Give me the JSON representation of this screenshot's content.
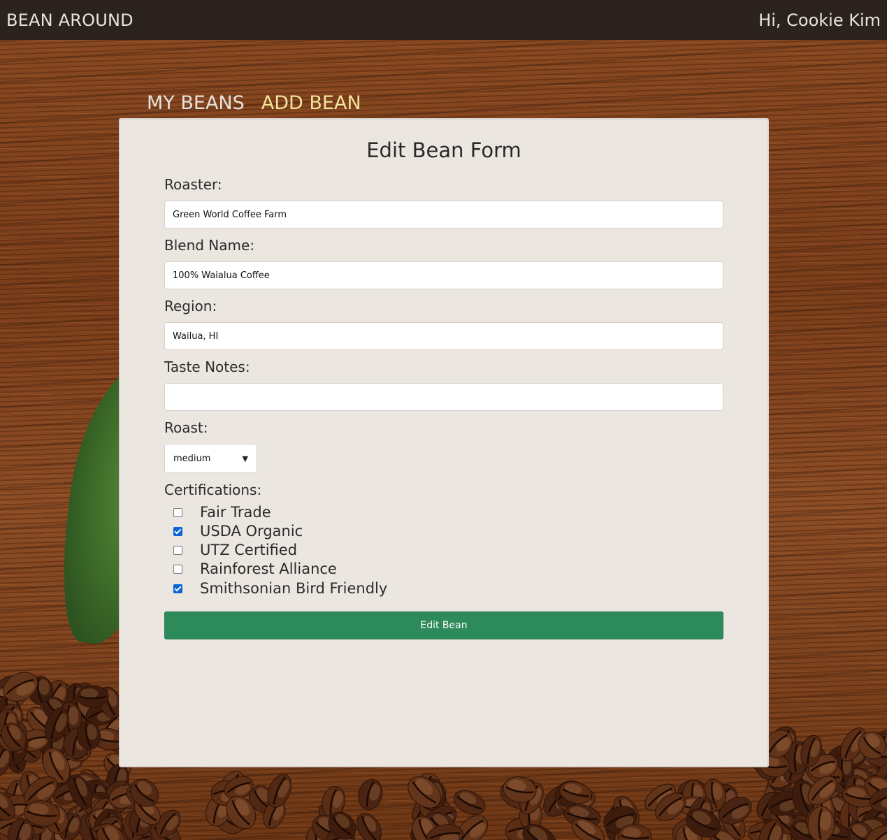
{
  "navbar": {
    "brand": "BEAN AROUND",
    "greeting": "Hi, Cookie Kim"
  },
  "tabs": {
    "my_beans": "MY BEANS",
    "add_bean": "ADD BEAN"
  },
  "form": {
    "title": "Edit Bean Form",
    "roaster_label": "Roaster:",
    "roaster_value": "Green World Coffee Farm",
    "blend_label": "Blend Name:",
    "blend_value": "100% Waialua Coffee",
    "region_label": "Region:",
    "region_value": "Wailua, HI",
    "taste_label": "Taste Notes:",
    "taste_value": "",
    "roast_label": "Roast:",
    "roast_value": "medium",
    "certifications_label": "Certifications:",
    "certifications": [
      {
        "label": "Fair Trade",
        "checked": false
      },
      {
        "label": "USDA Organic",
        "checked": true
      },
      {
        "label": "UTZ Certified",
        "checked": false
      },
      {
        "label": "Rainforest Alliance",
        "checked": false
      },
      {
        "label": "Smithsonian Bird Friendly",
        "checked": true
      }
    ],
    "submit_label": "Edit Bean"
  },
  "colors": {
    "navbar_bg": "#2b211d",
    "active_tab": "#f4e39a",
    "submit_bg": "#2d8a5a",
    "panel_bg": "#ebe6e0",
    "checkbox_checked": "#0b65d8"
  }
}
